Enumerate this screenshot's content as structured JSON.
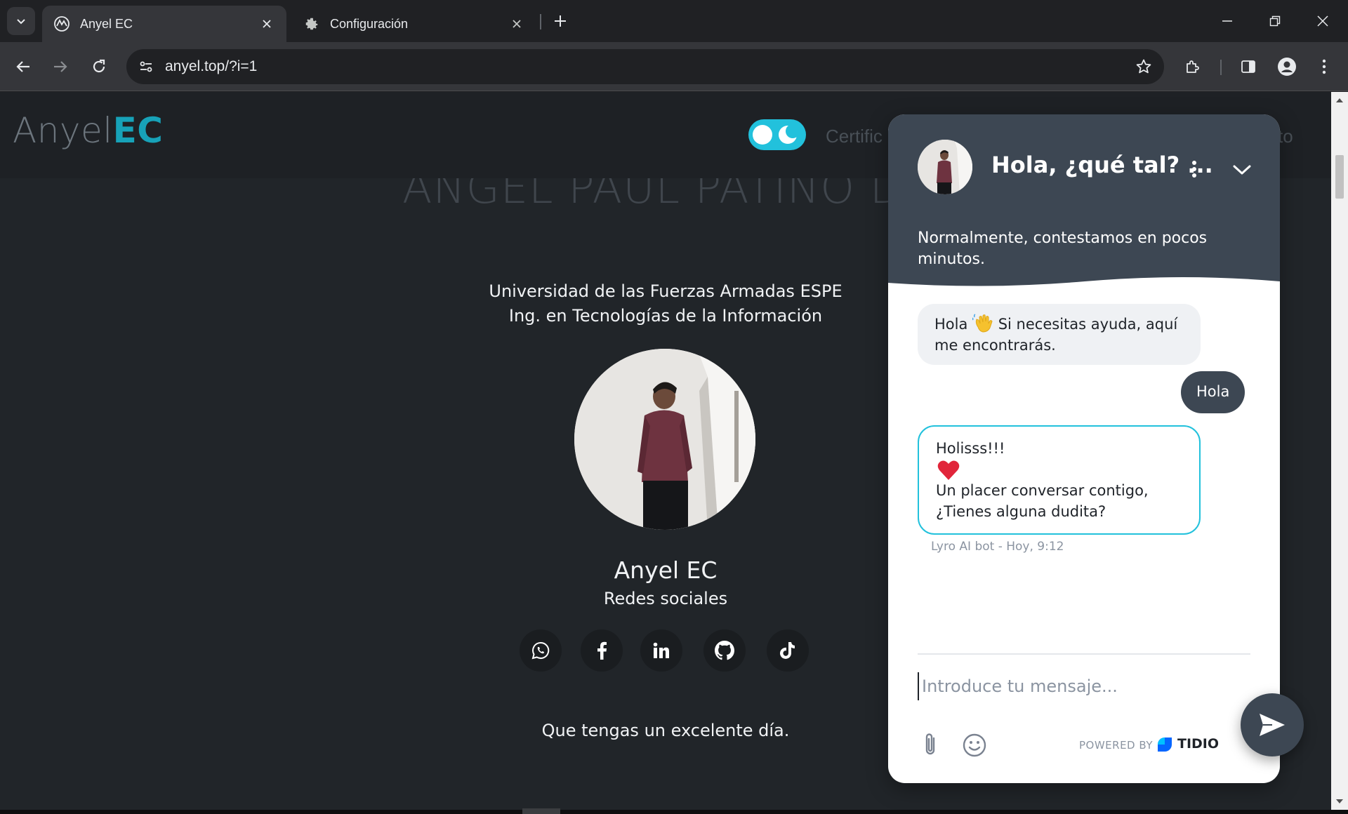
{
  "browser": {
    "tabs": [
      {
        "title": "Anyel EC",
        "active": true
      },
      {
        "title": "Configuración",
        "active": false
      }
    ],
    "url": "anyel.top/?i=1"
  },
  "site": {
    "brand": {
      "light": "Anyel",
      "bold": "EC"
    },
    "nav": {
      "link1": "Certific",
      "link2": "to"
    },
    "big_name": "ANGEL PAUL PATIÑO DÍA",
    "university_line1": "Universidad de las Fuerzas Armadas ESPE",
    "university_line2": "Ing. en Tecnologías de la Información",
    "display_name": "Anyel EC",
    "social_label": "Redes sociales",
    "social_icons": [
      "whatsapp-icon",
      "facebook-icon",
      "linkedin-icon",
      "github-icon",
      "tiktok-icon"
    ],
    "greeting": "Que tengas un excelente día."
  },
  "chat": {
    "title": "Hola, ¿qué tal? ...",
    "subtitle": "Normalmente, contestamos en pocos minutos.",
    "bot_msg1_a": "Hola",
    "bot_msg1_b": "Si necesitas ayuda, aquí me encontrarás.",
    "user_msg": "Hola",
    "bot_msg2_line1": "Holisss!!!",
    "bot_msg2_line2": "Un placer conversar contigo, ¿Tienes alguna dudita?",
    "meta": "Lyro AI bot - Hoy, 9:12",
    "input_placeholder": "Introduce tu mensaje...",
    "powered_by": "POWERED BY",
    "brand": "TIDIO"
  },
  "colors": {
    "accent": "#17a2b8",
    "toggle": "#22c1dc",
    "chat_header": "#3d4753",
    "page_bg": "#212529"
  }
}
